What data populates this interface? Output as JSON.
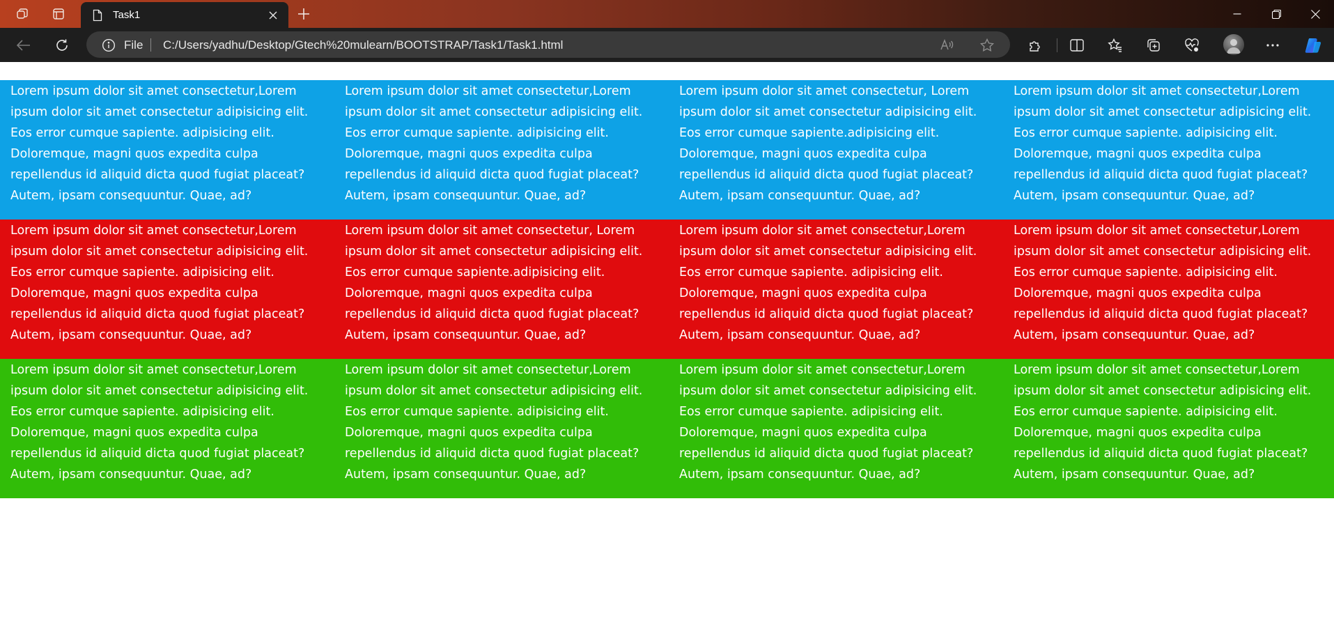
{
  "browser": {
    "tab": {
      "title": "Task1"
    },
    "address": {
      "scheme_label": "File",
      "url": "C:/Users/yadhu/Desktop/Gtech%20mulearn/BOOTSTRAP/Task1/Task1.html"
    },
    "icons": {
      "workspaces": "workspaces-icon",
      "tab_actions": "tab-actions-icon",
      "page": "page-icon",
      "close_tab": "close-icon",
      "new_tab": "plus-icon",
      "minimize": "minimize-icon",
      "restore": "restore-icon",
      "close_window": "close-window-icon",
      "back": "back-arrow-icon",
      "refresh": "refresh-icon",
      "info": "info-icon",
      "read_aloud": "read-aloud-icon",
      "favorite": "star-icon",
      "extensions": "puzzle-icon",
      "split_screen": "split-screen-icon",
      "favorites": "favorites-icon",
      "collections": "collections-icon",
      "performance": "heart-pulse-icon",
      "profile": "avatar",
      "more": "more-icon",
      "copilot": "copilot-icon"
    },
    "colors": {
      "tab_strip_start": "#b8401f",
      "tab_strip_end": "#1a0d09",
      "toolbar": "#1e1e1e",
      "address_bar": "#3a3a3a"
    }
  },
  "page": {
    "colors": {
      "blue_row": "#0ea2e6",
      "red_row": "#e00c0e",
      "green_row": "#31bd08"
    },
    "rows": [
      {
        "name": "blue",
        "cells": [
          [
            "Lorem ipsum dolor sit amet consectetur,Lorem",
            "ipsum dolor sit amet consectetur adipisicing elit.",
            "Eos error cumque sapiente. adipisicing elit.",
            "Doloremque, magni quos expedita culpa",
            "repellendus id aliquid dicta quod fugiat placeat?",
            "Autem, ipsam consequuntur. Quae, ad?"
          ],
          [
            "Lorem ipsum dolor sit amet consectetur,Lorem",
            "ipsum dolor sit amet consectetur adipisicing elit.",
            "Eos error cumque sapiente. adipisicing elit.",
            "Doloremque, magni quos expedita culpa",
            "repellendus id aliquid dicta quod fugiat placeat?",
            "Autem, ipsam consequuntur. Quae, ad?"
          ],
          [
            "Lorem ipsum dolor sit amet consectetur, Lorem",
            "ipsum dolor sit amet consectetur adipisicing elit.",
            "Eos error cumque sapiente.adipisicing elit.",
            "Doloremque, magni quos expedita culpa",
            "repellendus id aliquid dicta quod fugiat placeat?",
            "Autem, ipsam consequuntur. Quae, ad?"
          ],
          [
            "Lorem ipsum dolor sit amet consectetur,Lorem",
            "ipsum dolor sit amet consectetur adipisicing elit.",
            "Eos error cumque sapiente. adipisicing elit.",
            "Doloremque, magni quos expedita culpa",
            "repellendus id aliquid dicta quod fugiat placeat?",
            "Autem, ipsam consequuntur. Quae, ad?"
          ]
        ]
      },
      {
        "name": "red",
        "cells": [
          [
            "Lorem ipsum dolor sit amet consectetur,Lorem",
            "ipsum dolor sit amet consectetur adipisicing elit.",
            "Eos error cumque sapiente. adipisicing elit.",
            "Doloremque, magni quos expedita culpa",
            "repellendus id aliquid dicta quod fugiat placeat?",
            "Autem, ipsam consequuntur. Quae, ad?"
          ],
          [
            "Lorem ipsum dolor sit amet consectetur, Lorem",
            "ipsum dolor sit amet consectetur adipisicing elit.",
            "Eos error cumque sapiente.adipisicing elit.",
            "Doloremque, magni quos expedita culpa",
            "repellendus id aliquid dicta quod fugiat placeat?",
            "Autem, ipsam consequuntur. Quae, ad?"
          ],
          [
            "Lorem ipsum dolor sit amet consectetur,Lorem",
            "ipsum dolor sit amet consectetur adipisicing elit.",
            "Eos error cumque sapiente. adipisicing elit.",
            "Doloremque, magni quos expedita culpa",
            "repellendus id aliquid dicta quod fugiat placeat?",
            "Autem, ipsam consequuntur. Quae, ad?"
          ],
          [
            "Lorem ipsum dolor sit amet consectetur,Lorem",
            "ipsum dolor sit amet consectetur adipisicing elit.",
            "Eos error cumque sapiente. adipisicing elit.",
            "Doloremque, magni quos expedita culpa",
            "repellendus id aliquid dicta quod fugiat placeat?",
            "Autem, ipsam consequuntur. Quae, ad?"
          ]
        ]
      },
      {
        "name": "green",
        "cells": [
          [
            "Lorem ipsum dolor sit amet consectetur,Lorem",
            "ipsum dolor sit amet consectetur adipisicing elit.",
            "Eos error cumque sapiente. adipisicing elit.",
            "Doloremque, magni quos expedita culpa",
            "repellendus id aliquid dicta quod fugiat placeat?",
            "Autem, ipsam consequuntur. Quae, ad?"
          ],
          [
            "Lorem ipsum dolor sit amet consectetur,Lorem",
            "ipsum dolor sit amet consectetur adipisicing elit.",
            "Eos error cumque sapiente. adipisicing elit.",
            "Doloremque, magni quos expedita culpa",
            "repellendus id aliquid dicta quod fugiat placeat?",
            "Autem, ipsam consequuntur. Quae, ad?"
          ],
          [
            "Lorem ipsum dolor sit amet consectetur,Lorem",
            "ipsum dolor sit amet consectetur adipisicing elit.",
            "Eos error cumque sapiente. adipisicing elit.",
            "Doloremque, magni quos expedita culpa",
            "repellendus id aliquid dicta quod fugiat placeat?",
            "Autem, ipsam consequuntur. Quae, ad?"
          ],
          [
            "Lorem ipsum dolor sit amet consectetur,Lorem",
            "ipsum dolor sit amet consectetur adipisicing elit.",
            "Eos error cumque sapiente. adipisicing elit.",
            "Doloremque, magni quos expedita culpa",
            "repellendus id aliquid dicta quod fugiat placeat?",
            "Autem, ipsam consequuntur. Quae, ad?"
          ]
        ]
      }
    ]
  }
}
